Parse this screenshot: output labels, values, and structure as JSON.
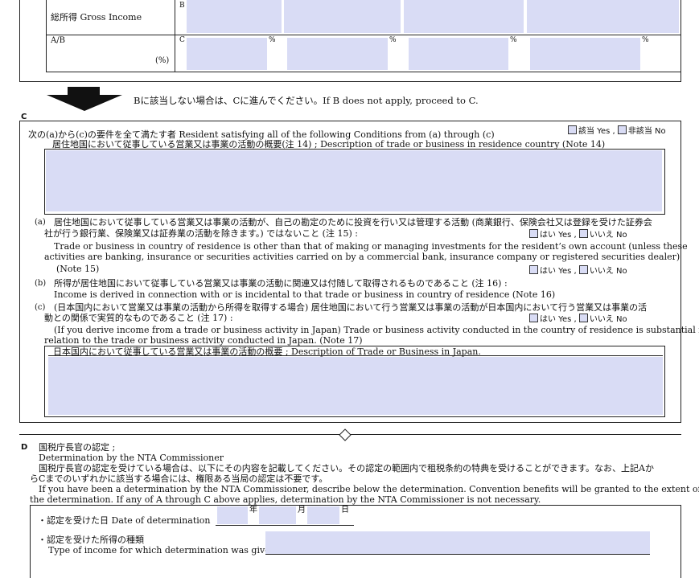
{
  "top_table": {
    "gross_income_label": "総所得 Gross Income",
    "row_b_marker": "B",
    "ab_label": "A/B",
    "percent_paren": "(%)",
    "row_c_marker": "C",
    "percent_sign": "%"
  },
  "arrow_note": "Bに該当しない場合は、Cに進んでください。If B does not apply, proceed to C.",
  "section_c": {
    "letter": "C",
    "intro": "次の(a)から(c)の要件を全て満たす者 Resident satisfying all of the following Conditions from  (a)  through  (c)",
    "yes_no_main": {
      "yes": "該当 Yes ,",
      "no": "非該当 No"
    },
    "desc_label": "居住地国において従事している営業又は事業の活動の概要(注 14) ; Description of trade or business in residence country (Note 14)",
    "a_mark": "(a)",
    "a_jp1": "居住地国において従事している営業又は事業の活動が、自己の勘定のために投資を行い又は管理する活動 (商業銀行、保険会社又は登録を受けた証券会",
    "a_jp2": "社が行う銀行業、保険業又は証券業の活動を除きます。) ではないこと (注 15) :",
    "a_en1": "Trade or business in country of residence is other than that of making or managing investments for the resident’s own account (unless these",
    "a_en2": "activities are banking, insurance or securities activities carried on by a commercial bank, insurance company or registered securities dealer)",
    "a_en3": "(Note 15)",
    "yes": "はい Yes ,",
    "no": "いいえ No",
    "b_mark": "(b)",
    "b_jp": "所得が居住地国において従事している営業又は事業の活動に関連又は付随して取得されるものであること (注 16) :",
    "b_en": "Income is derived in connection with or is incidental to that trade or business in country of residence (Note 16)",
    "c_mark": "(c)",
    "c_jp1": "(日本国内において営業又は事業の活動から所得を取得する場合) 居住地国において行う営業又は事業の活動が日本国内において行う営業又は事業の活",
    "c_jp2": "動との関係で実質的なものであること (注 17) :",
    "c_en1": "(If you derive income from a trade or business activity in Japan) Trade or business activity conducted in the country of residence is substantial in",
    "c_en2": "relation to the trade or business activity conducted in Japan. (Note 17)",
    "japan_desc_label": "日本国内において従事している営業又は事業の活動の概要 ; Description of Trade or Business in Japan."
  },
  "section_d": {
    "letter": "D",
    "title_jp": "国税庁長官の認定 ;",
    "title_en": "Determination by the NTA Commissioner",
    "jp1": "国税庁長官の認定を受けている場合は、以下にその内容を記載してください。その認定の範囲内で租税条約の特典を受けることができます。なお、上記Aか",
    "jp2": "らCまでのいずれかに該当する場合には、権限ある当局の認定は不要です。",
    "en1": "If you have been a determination by the NTA Commissioner, describe below the determination. Convention benefits will be granted to the extent of",
    "en2": "the determination. If any of A through C above applies, determination by the NTA Commissioner is not necessary.",
    "date_label": "・認定を受けた日  Date of determination",
    "year": "年",
    "month": "月",
    "day": "日",
    "type_label_jp": "・認定を受けた所得の種類",
    "type_label_en": "Type of income for which determination was given"
  }
}
